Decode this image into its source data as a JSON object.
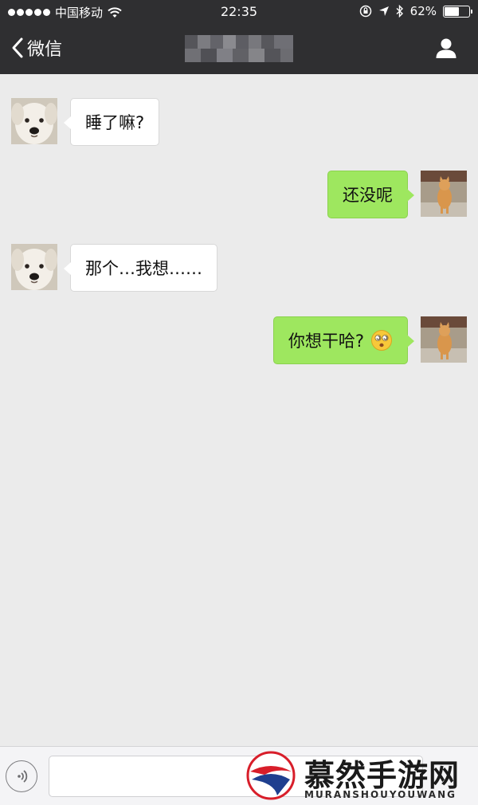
{
  "status_bar": {
    "carrier": "中国移动",
    "time": "22:35",
    "battery": "62%",
    "battery_level": 0.62
  },
  "nav": {
    "back_label": "微信"
  },
  "messages": [
    {
      "side": "left",
      "avatar": "dog",
      "text": "睡了嘛?"
    },
    {
      "side": "right",
      "avatar": "cat",
      "text": "还没呢"
    },
    {
      "side": "left",
      "avatar": "dog",
      "text": "那个…我想……"
    },
    {
      "side": "right",
      "avatar": "cat",
      "text": "你想干哈?",
      "emoji": "dizzy-face-emoji"
    }
  ],
  "input": {
    "placeholder": ""
  },
  "watermark": {
    "title": "慕然手游网",
    "subtitle": "MURANSHOUYOUWANG"
  },
  "colors": {
    "nav_background": "#2f2f31",
    "chat_background": "#ebebeb",
    "outgoing_bubble": "#9ee75f",
    "incoming_bubble": "#ffffff"
  }
}
